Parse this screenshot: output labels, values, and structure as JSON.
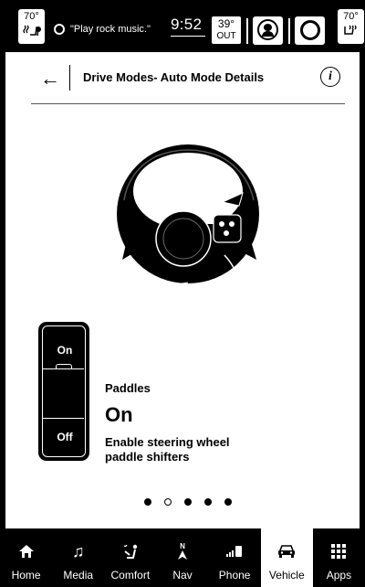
{
  "status": {
    "left_temp": "70°",
    "voice_prompt": "\"Play rock music.\"",
    "time": "9:52",
    "outside_temp": "39°",
    "outside_label": "OUT",
    "right_temp": "70°"
  },
  "header": {
    "title": "Drive Modes- Auto Mode Details",
    "back_icon": "back-arrow-icon",
    "info_icon": "info-icon",
    "info_glyph": "i"
  },
  "toggle": {
    "on_label": "On",
    "off_label": "Off"
  },
  "feature": {
    "name": "Paddles",
    "value": "On",
    "description": "Enable steering wheel paddle shifters"
  },
  "pagination": {
    "total": 5,
    "current": 2
  },
  "nav": {
    "items": [
      {
        "label": "Home",
        "icon": "home-icon"
      },
      {
        "label": "Media",
        "icon": "music-note-icon"
      },
      {
        "label": "Comfort",
        "icon": "comfort-seat-icon"
      },
      {
        "label": "Nav",
        "icon": "navigation-arrow-icon",
        "compass": "N"
      },
      {
        "label": "Phone",
        "icon": "phone-signal-icon"
      },
      {
        "label": "Vehicle",
        "icon": "car-icon",
        "active": true
      },
      {
        "label": "Apps",
        "icon": "apps-grid-icon"
      }
    ]
  }
}
